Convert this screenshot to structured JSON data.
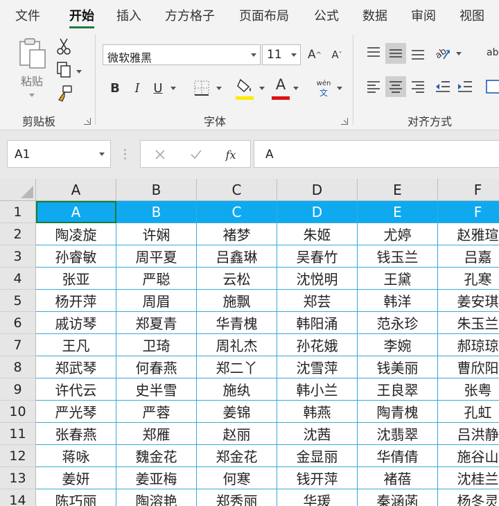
{
  "tabs": [
    "文件",
    "开始",
    "插入",
    "方方格子",
    "页面布局",
    "公式",
    "数据",
    "审阅",
    "视图"
  ],
  "active_tab": "开始",
  "ribbon": {
    "clipboard": {
      "paste_label": "粘贴",
      "group_label": "剪贴板"
    },
    "font": {
      "font_name": "微软雅黑",
      "font_size": "11",
      "grow_label": "A",
      "shrink_label": "A",
      "bold": "B",
      "italic": "I",
      "underline": "U",
      "font_color_letter": "A",
      "phonetic_top": "wén",
      "phonetic_bottom": "文",
      "group_label": "字体",
      "fill_color": "#ffeb00",
      "font_color": "#e01010"
    },
    "alignment": {
      "group_label": "对齐方式",
      "wrap_letters": "ab"
    }
  },
  "formula_bar": {
    "name_box": "A1",
    "fx": "fx",
    "value": "A"
  },
  "sheet": {
    "columns": [
      "A",
      "B",
      "C",
      "D",
      "E",
      "F"
    ],
    "rows": [
      [
        "1",
        "A",
        "B",
        "C",
        "D",
        "E",
        "F"
      ],
      [
        "2",
        "陶凌旋",
        "许娴",
        "褚梦",
        "朱姬",
        "尤婷",
        "赵雅瑄"
      ],
      [
        "3",
        "孙睿敏",
        "周平夏",
        "吕鑫琳",
        "吴春竹",
        "钱玉兰",
        "吕嘉"
      ],
      [
        "4",
        "张亚",
        "严聪",
        "云松",
        "沈悦明",
        "王黛",
        "孔寒"
      ],
      [
        "5",
        "杨开萍",
        "周眉",
        "施飘",
        "郑芸",
        "韩洋",
        "姜安琪"
      ],
      [
        "6",
        "戚访琴",
        "郑夏青",
        "华青槐",
        "韩阳涌",
        "范永珍",
        "朱玉兰"
      ],
      [
        "7",
        "王凡",
        "卫琦",
        "周礼杰",
        "孙花娥",
        "李婉",
        "郝琼琼"
      ],
      [
        "8",
        "郑武琴",
        "何春燕",
        "郑二丫",
        "沈雪萍",
        "钱美丽",
        "曹欣阳"
      ],
      [
        "9",
        "许代云",
        "史半雪",
        "施纨",
        "韩小兰",
        "王良翠",
        "张粤"
      ],
      [
        "10",
        "严光琴",
        "严蓉",
        "姜锦",
        "韩燕",
        "陶青槐",
        "孔虹"
      ],
      [
        "11",
        "张春燕",
        "郑雁",
        "赵丽",
        "沈茜",
        "沈翡翠",
        "吕洪静"
      ],
      [
        "12",
        "蒋咏",
        "魏金花",
        "郑金花",
        "金显丽",
        "华倩倩",
        "施谷山"
      ],
      [
        "13",
        "姜妍",
        "姜亚梅",
        "何寒",
        "钱开萍",
        "褚蓓",
        "沈桂兰"
      ],
      [
        "14",
        "陈巧丽",
        "陶溶艳",
        "郑秀丽",
        "华瑗",
        "秦涵菡",
        "杨冬灵"
      ]
    ]
  }
}
